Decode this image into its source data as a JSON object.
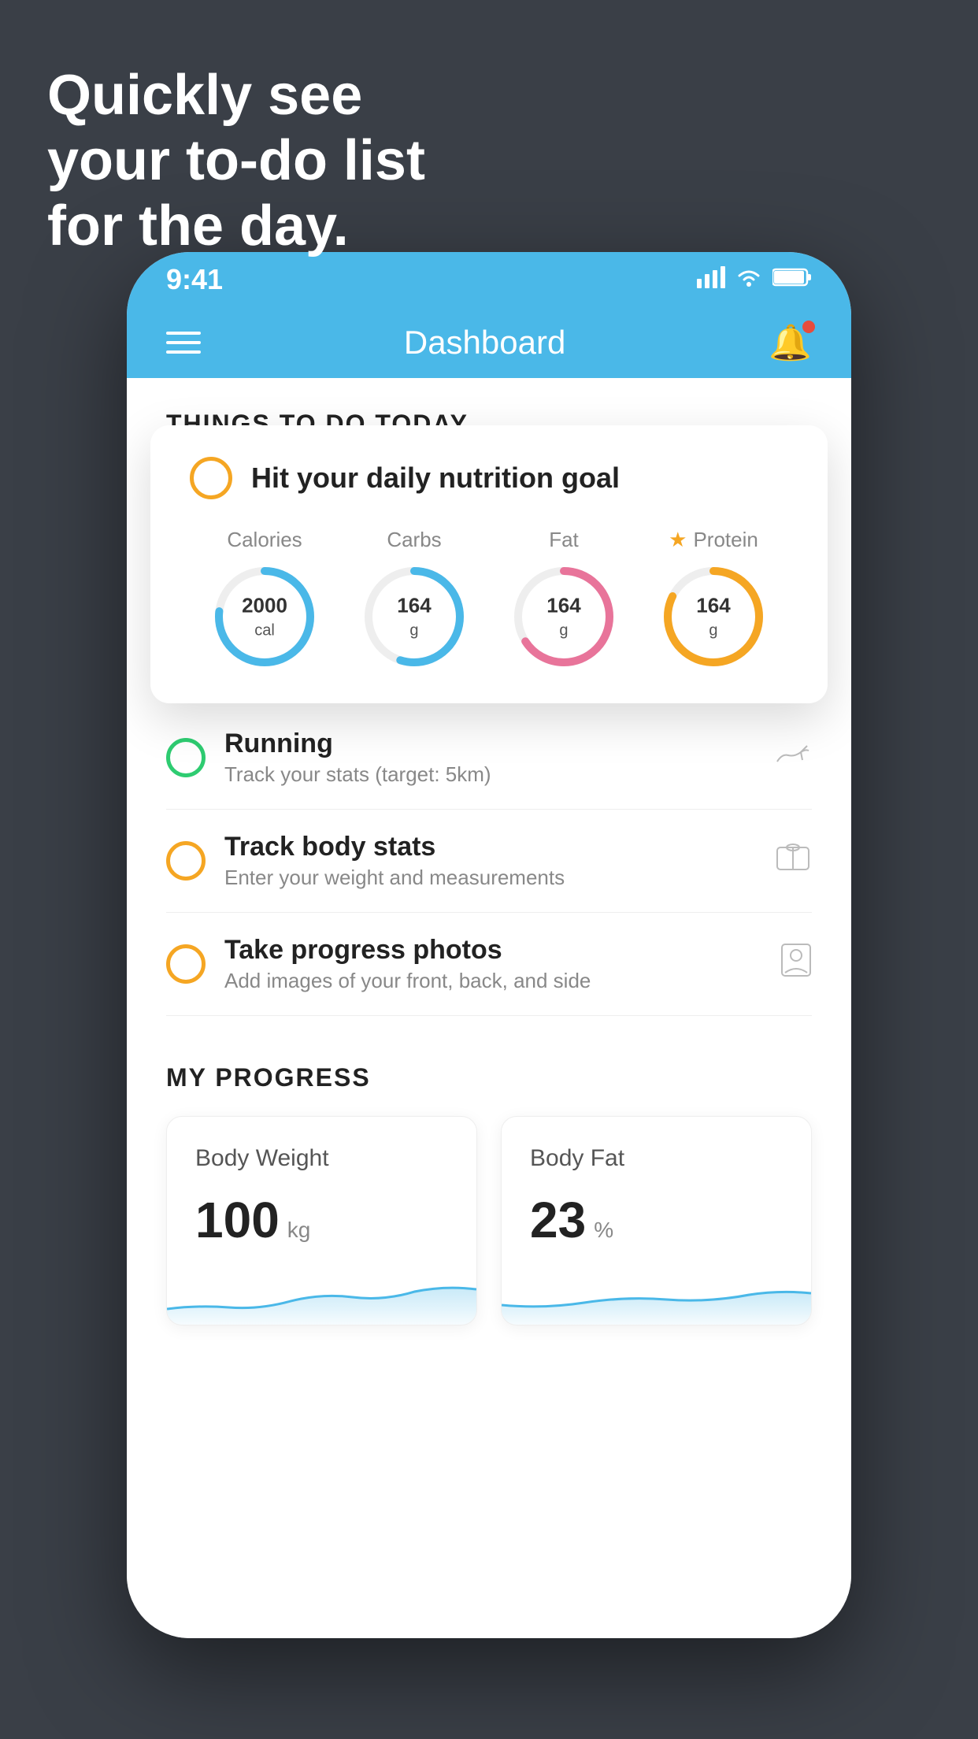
{
  "hero": {
    "line1": "Quickly see",
    "line2": "your to-do list",
    "line3": "for the day."
  },
  "phone": {
    "status_bar": {
      "time": "9:41",
      "signal": "▋▋▋▋",
      "wifi": "wifi",
      "battery": "battery"
    },
    "nav": {
      "title": "Dashboard"
    },
    "section": {
      "things_to_do": "THINGS TO DO TODAY"
    },
    "floating_card": {
      "title": "Hit your daily nutrition goal",
      "calories_label": "Calories",
      "calories_value": "2000",
      "calories_unit": "cal",
      "carbs_label": "Carbs",
      "carbs_value": "164",
      "carbs_unit": "g",
      "fat_label": "Fat",
      "fat_value": "164",
      "fat_unit": "g",
      "protein_label": "Protein",
      "protein_value": "164",
      "protein_unit": "g"
    },
    "todo_items": [
      {
        "title": "Running",
        "subtitle": "Track your stats (target: 5km)",
        "check_color": "green",
        "icon": "👟"
      },
      {
        "title": "Track body stats",
        "subtitle": "Enter your weight and measurements",
        "check_color": "yellow",
        "icon": "⚖"
      },
      {
        "title": "Take progress photos",
        "subtitle": "Add images of your front, back, and side",
        "check_color": "yellow",
        "icon": "👤"
      }
    ],
    "progress": {
      "section_title": "MY PROGRESS",
      "cards": [
        {
          "title": "Body Weight",
          "value": "100",
          "unit": "kg"
        },
        {
          "title": "Body Fat",
          "value": "23",
          "unit": "%"
        }
      ]
    }
  }
}
